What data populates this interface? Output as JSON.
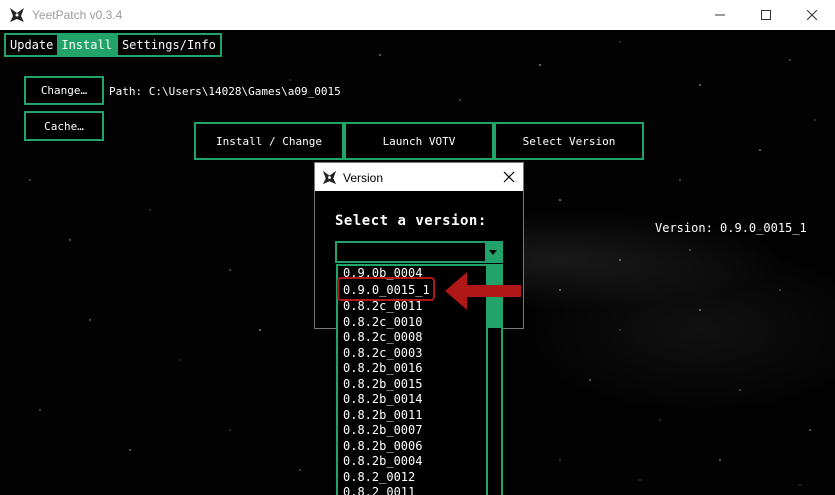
{
  "window": {
    "title": "YeetPatch v0.3.4"
  },
  "tabs": [
    {
      "label": "Update"
    },
    {
      "label": "Install"
    },
    {
      "label": "Settings/Info"
    }
  ],
  "install": {
    "change_label": "Change…",
    "cache_label": "Cache…",
    "path_text": "Path: C:\\Users\\14028\\Games\\a09_0015",
    "install_change_label": "Install / Change",
    "launch_label": "Launch VOTV",
    "select_version_label": "Select Version",
    "version_text": "Version: 0.9.0_0015_1"
  },
  "dialog": {
    "title": "Version",
    "prompt": "Select a version:",
    "combo_value": ""
  },
  "dropdown": {
    "items": [
      "0.9.0b_0004",
      "0.9.0_0015_1",
      "0.8.2c_0011",
      "0.8.2c_0010",
      "0.8.2c_0008",
      "0.8.2c_0003",
      "0.8.2b_0016",
      "0.8.2b_0015",
      "0.8.2b_0014",
      "0.8.2b_0011",
      "0.8.2b_0007",
      "0.8.2b_0006",
      "0.8.2b_0004",
      "0.8.2_0012",
      "0.8.2_0011"
    ],
    "highlighted_item": "0.9.0_0015_1"
  },
  "colors": {
    "accent": "#22a36a",
    "annotation": "#b01818",
    "background": "#000000"
  },
  "icons": [
    "app-fox-icon",
    "minimize-icon",
    "maximize-icon",
    "close-icon",
    "chevron-down-icon",
    "annotation-arrow-icon"
  ]
}
